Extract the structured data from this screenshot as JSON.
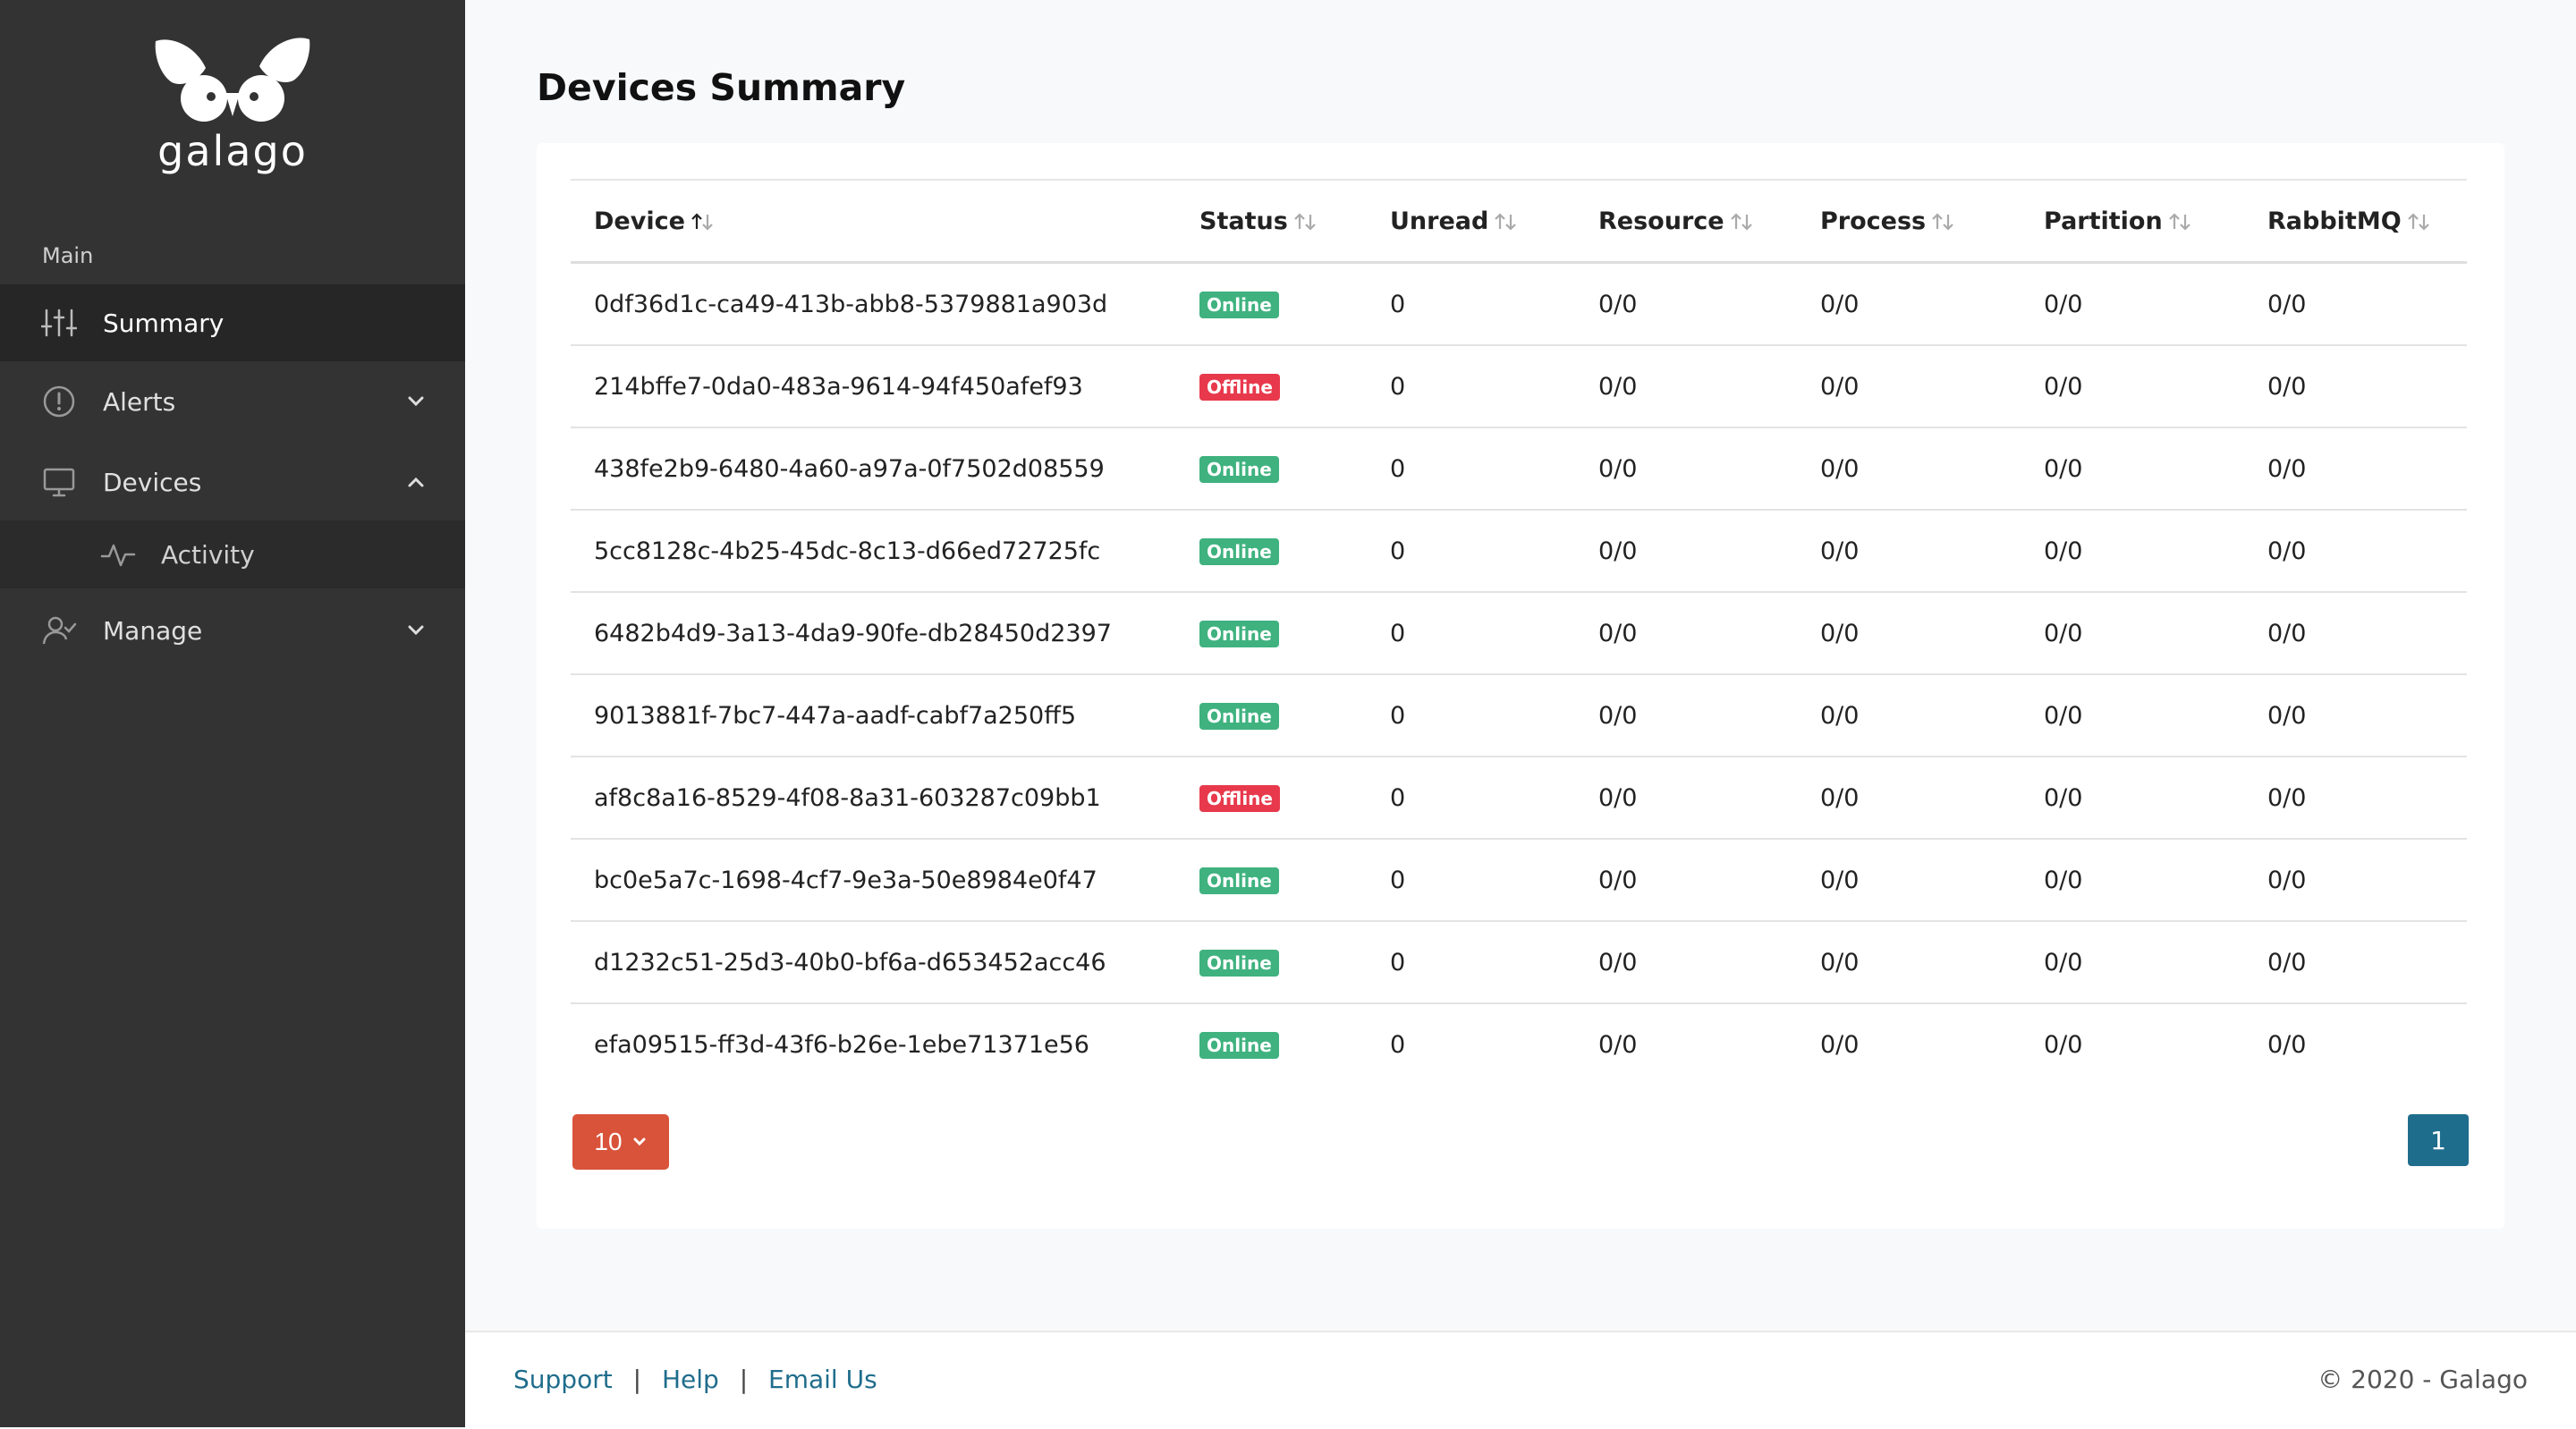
{
  "brand": {
    "name": "galago"
  },
  "sidebar": {
    "section_label": "Main",
    "items": [
      {
        "label": "Summary",
        "icon": "sliders-icon",
        "active": true
      },
      {
        "label": "Alerts",
        "icon": "alert-circle-icon",
        "expanded": false
      },
      {
        "label": "Devices",
        "icon": "monitor-icon",
        "expanded": true
      },
      {
        "label": "Activity",
        "icon": "activity-icon",
        "sub": true
      },
      {
        "label": "Manage",
        "icon": "user-check-icon",
        "expanded": false
      }
    ]
  },
  "main": {
    "title": "Devices Summary",
    "columns": [
      "Device",
      "Status",
      "Unread",
      "Resource",
      "Process",
      "Partition",
      "RabbitMQ"
    ],
    "status_colors": {
      "Online": "#3fb27f",
      "Offline": "#e8394c"
    },
    "rows": [
      {
        "device": "0df36d1c-ca49-413b-abb8-5379881a903d",
        "status": "Online",
        "unread": "0",
        "resource": "0/0",
        "process": "0/0",
        "partition": "0/0",
        "rabbitmq": "0/0"
      },
      {
        "device": "214bffe7-0da0-483a-9614-94f450afef93",
        "status": "Offline",
        "unread": "0",
        "resource": "0/0",
        "process": "0/0",
        "partition": "0/0",
        "rabbitmq": "0/0"
      },
      {
        "device": "438fe2b9-6480-4a60-a97a-0f7502d08559",
        "status": "Online",
        "unread": "0",
        "resource": "0/0",
        "process": "0/0",
        "partition": "0/0",
        "rabbitmq": "0/0"
      },
      {
        "device": "5cc8128c-4b25-45dc-8c13-d66ed72725fc",
        "status": "Online",
        "unread": "0",
        "resource": "0/0",
        "process": "0/0",
        "partition": "0/0",
        "rabbitmq": "0/0"
      },
      {
        "device": "6482b4d9-3a13-4da9-90fe-db28450d2397",
        "status": "Online",
        "unread": "0",
        "resource": "0/0",
        "process": "0/0",
        "partition": "0/0",
        "rabbitmq": "0/0"
      },
      {
        "device": "9013881f-7bc7-447a-aadf-cabf7a250ff5",
        "status": "Online",
        "unread": "0",
        "resource": "0/0",
        "process": "0/0",
        "partition": "0/0",
        "rabbitmq": "0/0"
      },
      {
        "device": "af8c8a16-8529-4f08-8a31-603287c09bb1",
        "status": "Offline",
        "unread": "0",
        "resource": "0/0",
        "process": "0/0",
        "partition": "0/0",
        "rabbitmq": "0/0"
      },
      {
        "device": "bc0e5a7c-1698-4cf7-9e3a-50e8984e0f47",
        "status": "Online",
        "unread": "0",
        "resource": "0/0",
        "process": "0/0",
        "partition": "0/0",
        "rabbitmq": "0/0"
      },
      {
        "device": "d1232c51-25d3-40b0-bf6a-d653452acc46",
        "status": "Online",
        "unread": "0",
        "resource": "0/0",
        "process": "0/0",
        "partition": "0/0",
        "rabbitmq": "0/0"
      },
      {
        "device": "efa09515-ff3d-43f6-b26e-1ebe71371e56",
        "status": "Online",
        "unread": "0",
        "resource": "0/0",
        "process": "0/0",
        "partition": "0/0",
        "rabbitmq": "0/0"
      }
    ],
    "page_size": "10",
    "current_page": "1"
  },
  "footer": {
    "links": [
      "Support",
      "Help",
      "Email Us"
    ],
    "separator": "|",
    "copyright": "© 2020 - Galago"
  }
}
